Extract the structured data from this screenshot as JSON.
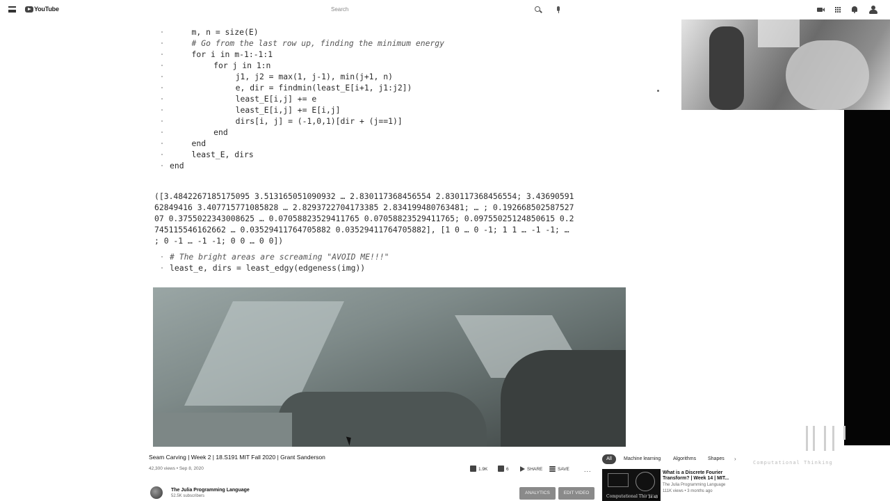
{
  "header": {
    "logo_text": "YouTube",
    "search_placeholder": "Search",
    "icons": [
      "menu-icon",
      "youtube-logo-icon",
      "search-icon",
      "mic-icon",
      "create-video-icon",
      "apps-icon",
      "notifications-icon",
      "account-icon"
    ]
  },
  "notebook": {
    "code_lines": [
      {
        "indent": 4,
        "text": "m, n = size(E)",
        "style": "code",
        "dot": true
      },
      {
        "indent": 4,
        "text": "# Go from the last row up, finding the minimum energy",
        "style": "comment",
        "dot": true
      },
      {
        "indent": 4,
        "text": "for i in m-1:-1:1",
        "style": "code",
        "dot": true
      },
      {
        "indent": 8,
        "text": "for j in 1:n",
        "style": "code",
        "dot": true
      },
      {
        "indent": 12,
        "text": "j1, j2 = max(1, j-1), min(j+1, n)",
        "style": "code",
        "dot": true
      },
      {
        "indent": 12,
        "text": "e, dir = findmin(least_E[i+1, j1:j2])",
        "style": "code",
        "dot": true
      },
      {
        "indent": 12,
        "text": "least_E[i,j] += e",
        "style": "code",
        "dot": true
      },
      {
        "indent": 12,
        "text": "least_E[i,j] += E[i,j]",
        "style": "code",
        "dot": true
      },
      {
        "indent": 12,
        "text": "dirs[i, j] = (-1,0,1)[dir + (j==1)]",
        "style": "code",
        "dot": true
      },
      {
        "indent": 8,
        "text": "end",
        "style": "code",
        "dot": true
      },
      {
        "indent": 4,
        "text": "end",
        "style": "code",
        "dot": true
      },
      {
        "indent": 4,
        "text": "least_E, dirs",
        "style": "code",
        "dot": true
      },
      {
        "indent": 0,
        "text": "end",
        "style": "code",
        "dot": true
      }
    ],
    "output_lines": [
      "([3.4842267185175095 3.513165051090932 … 2.830117368456554 2.830117368456554; 3.43690591",
      "62849416 3.407715771085828 … 2.8293722704173385 2.834199480763481; … ; 0.192668502587527",
      "07 0.3755022343008625 … 0.07058823529411765 0.07058823529411765; 0.09755025124850615 0.2",
      "745115546162662 … 0.03529411764705882 0.03529411764705882], [1 0 … 0 -1; 1 1 … -1 -1; …",
      "; 0 -1 … -1 -1; 0 0 … 0 0])"
    ],
    "cell2_lines": [
      {
        "text": "# The bright areas are screaming \"AVOID ME!!!\"",
        "style": "comment"
      },
      {
        "text": "least_e, dirs = least_edgy(edgeness(img))",
        "style": "code"
      }
    ]
  },
  "video": {
    "title": "Seam Carving | Week 2 | 18.S191 MIT Fall 2020 | Grant Sanderson",
    "views": "42,300 views",
    "date": "Sep 8, 2020",
    "likes": "1.9K",
    "dislikes": "6",
    "share_label": "SHARE",
    "save_label": "SAVE",
    "more_label": "...",
    "channel_name": "The Julia Programming Language",
    "subscribers": "52.5K subscribers",
    "analytics_label": "ANALYTICS",
    "edit_label": "EDIT VIDEO"
  },
  "sidebar": {
    "chips": [
      "All",
      "Machine learning",
      "Algorithms",
      "Shapes"
    ],
    "chips_next": "›",
    "recommendation": {
      "title": "What is a Discrete Fourier Transform? | Week 14 | MIT...",
      "channel": "The Julia Programming Language",
      "meta": "111K views • 3 months ago",
      "duration": "34:48",
      "thumb_caption": "Computational Thinking"
    }
  },
  "overlay": {
    "caption": "Computational Thinking"
  }
}
